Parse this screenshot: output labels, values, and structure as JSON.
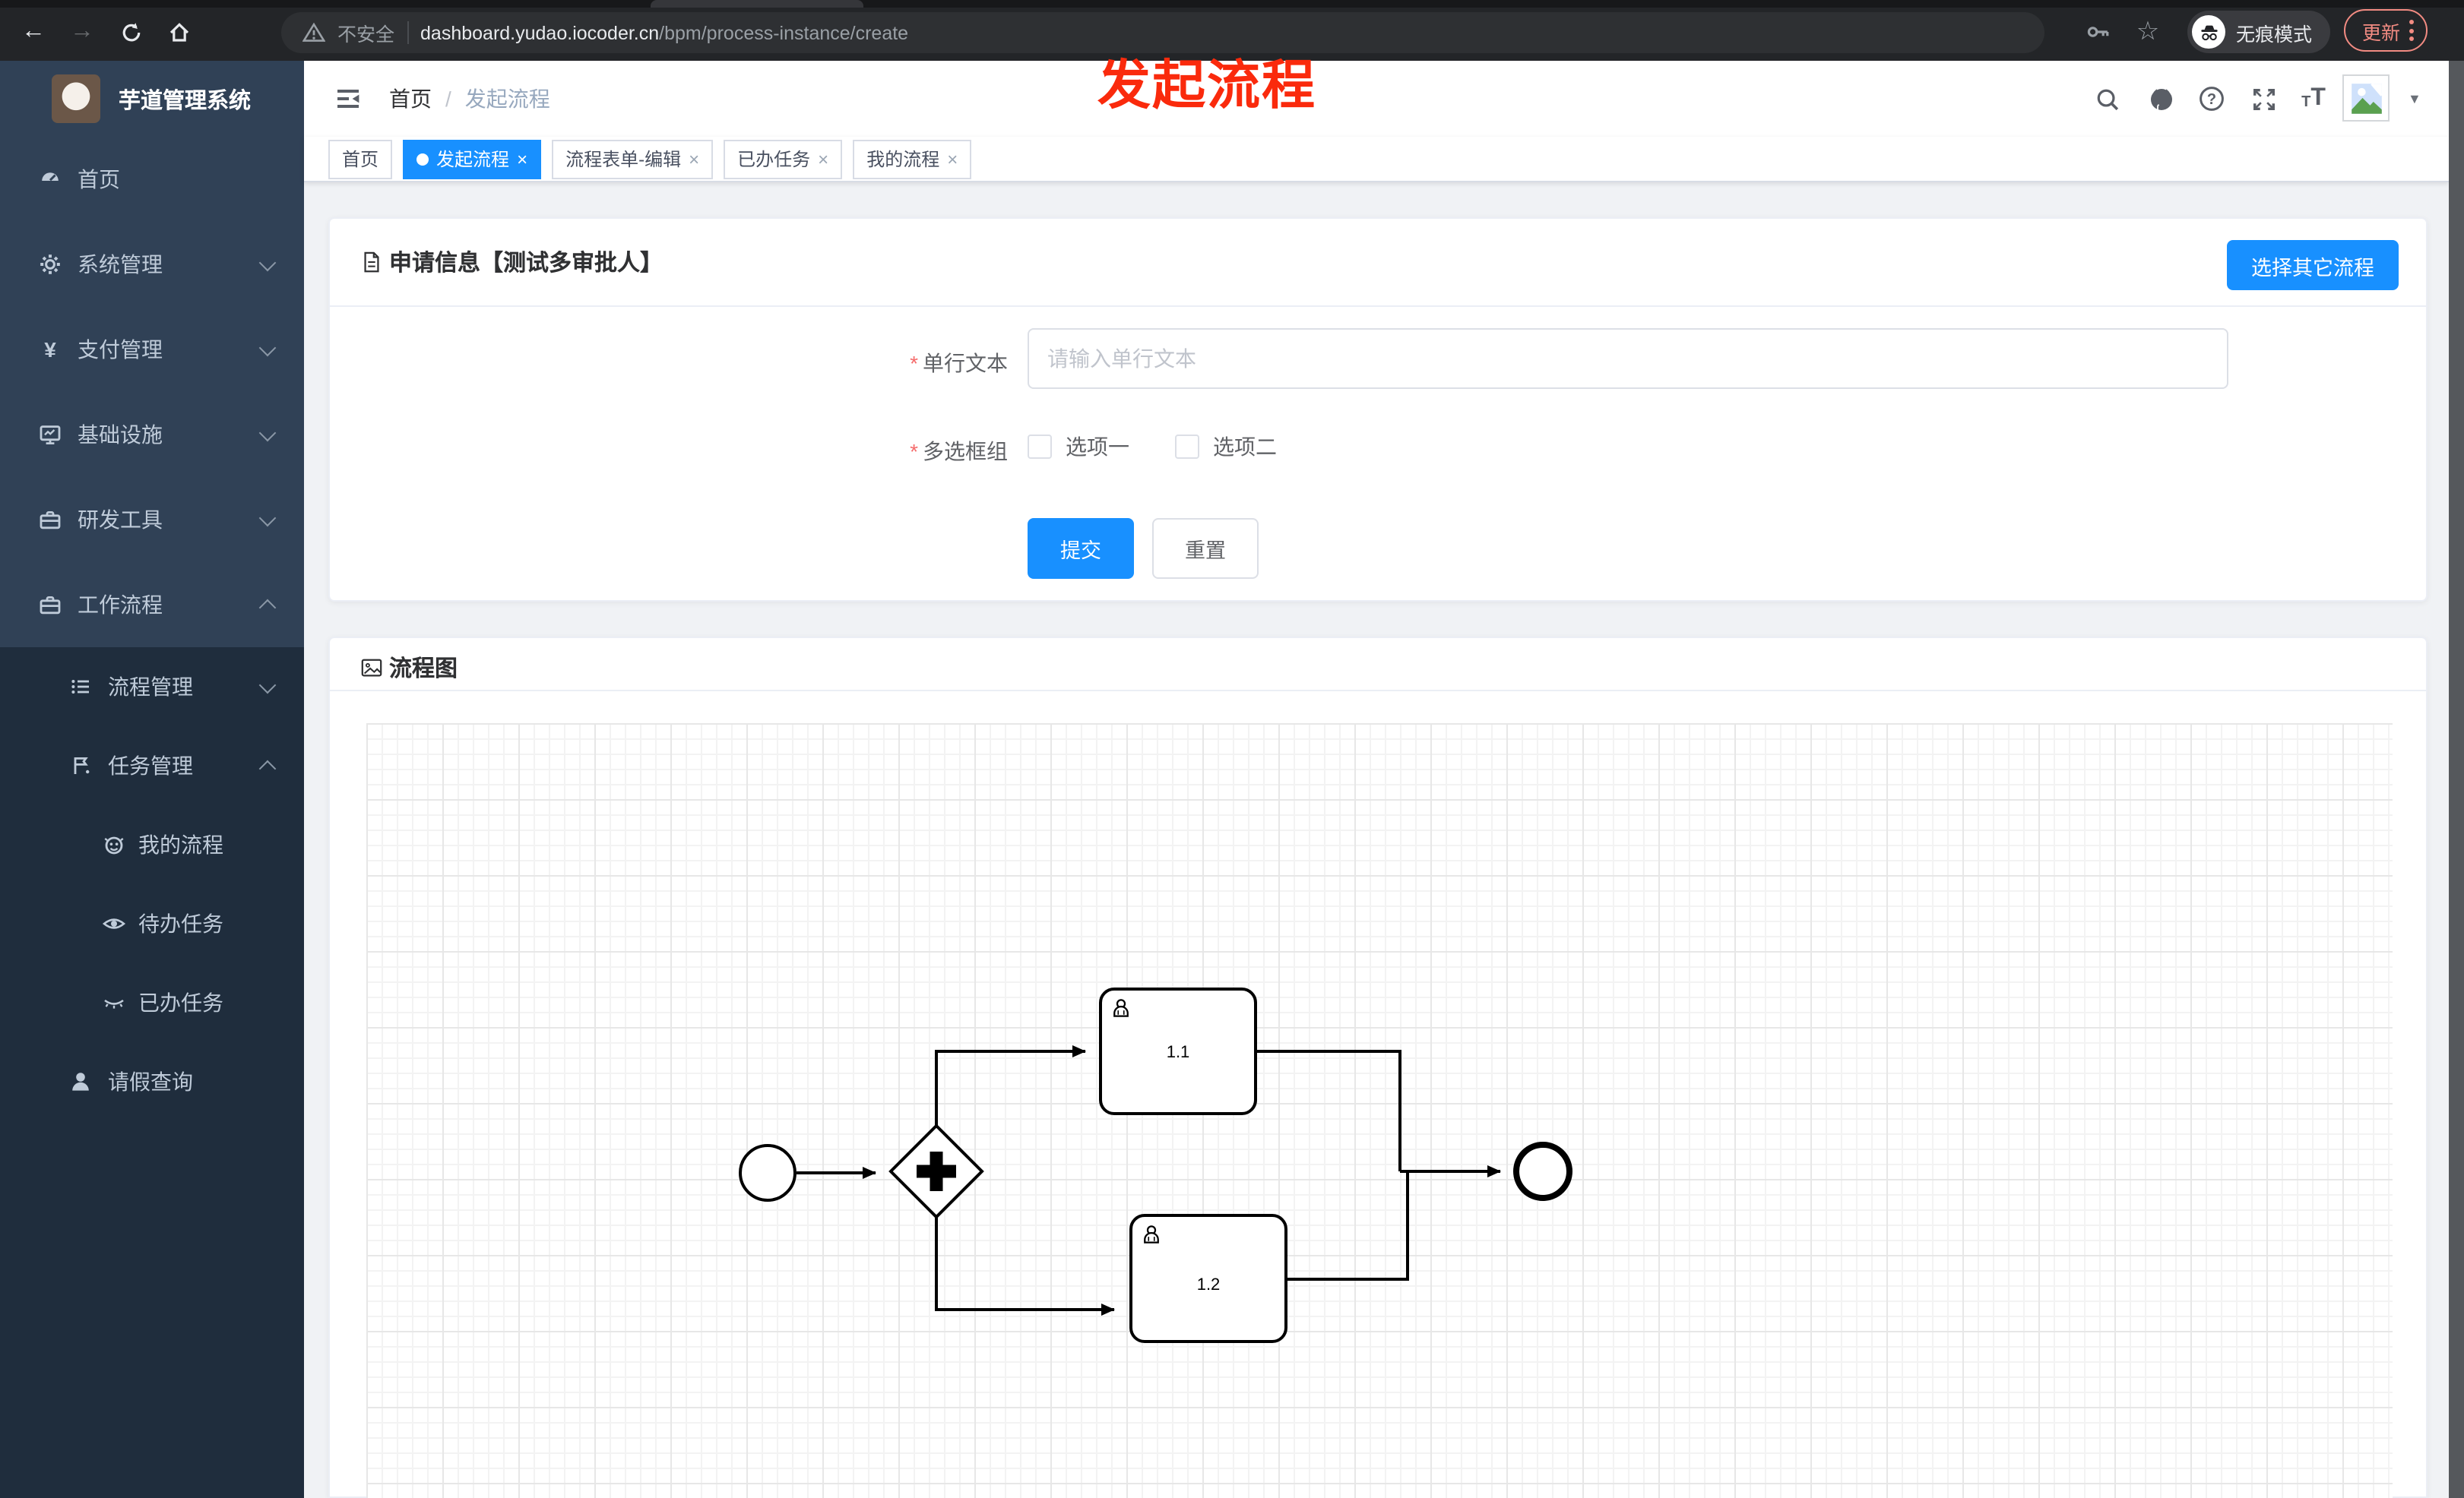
{
  "browser": {
    "security_label": "不安全",
    "url_domain": "dashboard.yudao.iocoder.cn",
    "url_path": "/bpm/process-instance/create",
    "incognito_label": "无痕模式",
    "update_label": "更新"
  },
  "annotation": {
    "text": "发起流程"
  },
  "sidebar": {
    "title": "芋道管理系统",
    "items": [
      {
        "label": "首页"
      },
      {
        "label": "系统管理"
      },
      {
        "label": "支付管理"
      },
      {
        "label": "基础设施"
      },
      {
        "label": "研发工具"
      },
      {
        "label": "工作流程"
      },
      {
        "label": "流程管理"
      },
      {
        "label": "任务管理"
      },
      {
        "label": "我的流程"
      },
      {
        "label": "待办任务"
      },
      {
        "label": "已办任务"
      },
      {
        "label": "请假查询"
      }
    ]
  },
  "breadcrumb": {
    "home": "首页",
    "separator": "/",
    "current": "发起流程"
  },
  "tabs": {
    "items": [
      {
        "label": "首页",
        "active": false,
        "closable": false
      },
      {
        "label": "发起流程",
        "active": true,
        "closable": true
      },
      {
        "label": "流程表单-编辑",
        "active": false,
        "closable": true
      },
      {
        "label": "已办任务",
        "active": false,
        "closable": true
      },
      {
        "label": "我的流程",
        "active": false,
        "closable": true
      }
    ]
  },
  "form_card": {
    "title": "申请信息【测试多审批人】",
    "select_other_process_button": "选择其它流程",
    "single_line_text": {
      "label": "单行文本",
      "required": true,
      "placeholder": "请输入单行文本",
      "value": ""
    },
    "checkbox_group": {
      "label": "多选框组",
      "required": true,
      "option1": "选项一",
      "option1_checked": false,
      "option2": "选项二",
      "option2_checked": false
    },
    "submit_button": "提交",
    "reset_button": "重置"
  },
  "diagram_card": {
    "title": "流程图",
    "bpmn": {
      "type": "bpmn-process-diagram",
      "nodes": [
        {
          "id": "start",
          "type": "startEvent"
        },
        {
          "id": "gateway",
          "type": "parallelGateway"
        },
        {
          "id": "task-1-1",
          "type": "userTask",
          "label": "1.1"
        },
        {
          "id": "task-1-2",
          "type": "userTask",
          "label": "1.2"
        },
        {
          "id": "end",
          "type": "endEvent"
        }
      ],
      "flows": [
        {
          "from": "start",
          "to": "gateway"
        },
        {
          "from": "gateway",
          "to": "task-1-1"
        },
        {
          "from": "gateway",
          "to": "task-1-2"
        },
        {
          "from": "task-1-1",
          "to": "end"
        },
        {
          "from": "task-1-2",
          "to": "end"
        }
      ],
      "task_1_1_label": "1.1",
      "task_1_2_label": "1.2"
    }
  },
  "ui": {
    "close_glyph": "×",
    "caret_glyph": "▼",
    "back_glyph": "←",
    "forward_glyph": "→",
    "star_glyph": "☆",
    "yen_glyph": "¥",
    "colors": {
      "primary": "#1890ff",
      "sidebar_bg": "#304156",
      "sidebar_submenu_bg": "#1f2d3d",
      "sidebar_text": "#bfcbd9",
      "annotation_red": "#fa2a0c",
      "required_red": "#f56c6c"
    }
  }
}
